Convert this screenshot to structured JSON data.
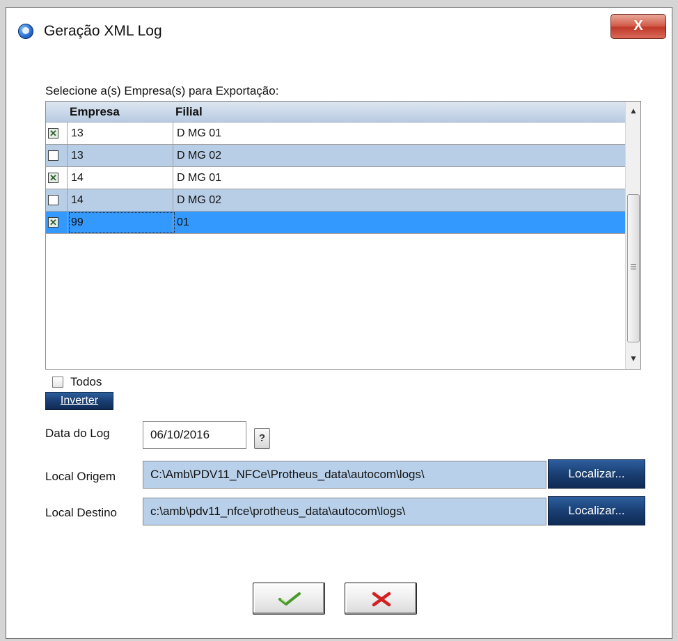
{
  "window": {
    "title": "Geração XML Log",
    "close_label": "X"
  },
  "instructions": "Selecione a(s) Empresa(s) para Exportação:",
  "table": {
    "columns": [
      "Empresa",
      "Filial"
    ],
    "rows": [
      {
        "checked": true,
        "empresa": "13",
        "filial": "D MG 01",
        "selected": false
      },
      {
        "checked": false,
        "empresa": "13",
        "filial": "D MG 02",
        "selected": false
      },
      {
        "checked": true,
        "empresa": "14",
        "filial": "D MG 01",
        "selected": false
      },
      {
        "checked": false,
        "empresa": "14",
        "filial": "D MG 02",
        "selected": false
      },
      {
        "checked": true,
        "empresa": "99",
        "filial": "01",
        "selected": true
      }
    ]
  },
  "todos_label": "Todos",
  "inverter_label": "Inverter",
  "data_log": {
    "label": "Data do Log",
    "value": "06/10/2016",
    "help": "?"
  },
  "local_origem": {
    "label": "Local Origem",
    "value": "C:\\Amb\\PDV11_NFCe\\Protheus_data\\autocom\\logs\\",
    "button": "Localizar..."
  },
  "local_destino": {
    "label": "Local Destino",
    "value": "c:\\amb\\pdv11_nfce\\protheus_data\\autocom\\logs\\",
    "button": "Localizar..."
  },
  "colors": {
    "row_alt": "#b8cde6",
    "row_plain": "#ffffff",
    "row_selected": "#3399ff",
    "field_bg": "#b8d0ea",
    "button_blue": "#1a3f73",
    "ok_icon": "#4a9a2a",
    "cancel_icon": "#d32020"
  },
  "icons": {
    "app": "app-globe-icon",
    "ok": "check-icon",
    "cancel": "x-icon"
  }
}
